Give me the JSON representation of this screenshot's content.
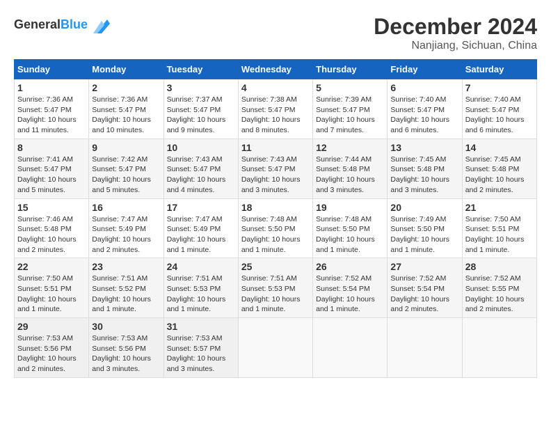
{
  "header": {
    "logo_line1": "General",
    "logo_line2": "Blue",
    "month": "December 2024",
    "location": "Nanjiang, Sichuan, China"
  },
  "calendar": {
    "days_of_week": [
      "Sunday",
      "Monday",
      "Tuesday",
      "Wednesday",
      "Thursday",
      "Friday",
      "Saturday"
    ],
    "weeks": [
      [
        {
          "day": "1",
          "sunrise": "Sunrise: 7:36 AM",
          "sunset": "Sunset: 5:47 PM",
          "daylight": "Daylight: 10 hours and 11 minutes."
        },
        {
          "day": "2",
          "sunrise": "Sunrise: 7:36 AM",
          "sunset": "Sunset: 5:47 PM",
          "daylight": "Daylight: 10 hours and 10 minutes."
        },
        {
          "day": "3",
          "sunrise": "Sunrise: 7:37 AM",
          "sunset": "Sunset: 5:47 PM",
          "daylight": "Daylight: 10 hours and 9 minutes."
        },
        {
          "day": "4",
          "sunrise": "Sunrise: 7:38 AM",
          "sunset": "Sunset: 5:47 PM",
          "daylight": "Daylight: 10 hours and 8 minutes."
        },
        {
          "day": "5",
          "sunrise": "Sunrise: 7:39 AM",
          "sunset": "Sunset: 5:47 PM",
          "daylight": "Daylight: 10 hours and 7 minutes."
        },
        {
          "day": "6",
          "sunrise": "Sunrise: 7:40 AM",
          "sunset": "Sunset: 5:47 PM",
          "daylight": "Daylight: 10 hours and 6 minutes."
        },
        {
          "day": "7",
          "sunrise": "Sunrise: 7:40 AM",
          "sunset": "Sunset: 5:47 PM",
          "daylight": "Daylight: 10 hours and 6 minutes."
        }
      ],
      [
        {
          "day": "8",
          "sunrise": "Sunrise: 7:41 AM",
          "sunset": "Sunset: 5:47 PM",
          "daylight": "Daylight: 10 hours and 5 minutes."
        },
        {
          "day": "9",
          "sunrise": "Sunrise: 7:42 AM",
          "sunset": "Sunset: 5:47 PM",
          "daylight": "Daylight: 10 hours and 5 minutes."
        },
        {
          "day": "10",
          "sunrise": "Sunrise: 7:43 AM",
          "sunset": "Sunset: 5:47 PM",
          "daylight": "Daylight: 10 hours and 4 minutes."
        },
        {
          "day": "11",
          "sunrise": "Sunrise: 7:43 AM",
          "sunset": "Sunset: 5:47 PM",
          "daylight": "Daylight: 10 hours and 3 minutes."
        },
        {
          "day": "12",
          "sunrise": "Sunrise: 7:44 AM",
          "sunset": "Sunset: 5:48 PM",
          "daylight": "Daylight: 10 hours and 3 minutes."
        },
        {
          "day": "13",
          "sunrise": "Sunrise: 7:45 AM",
          "sunset": "Sunset: 5:48 PM",
          "daylight": "Daylight: 10 hours and 3 minutes."
        },
        {
          "day": "14",
          "sunrise": "Sunrise: 7:45 AM",
          "sunset": "Sunset: 5:48 PM",
          "daylight": "Daylight: 10 hours and 2 minutes."
        }
      ],
      [
        {
          "day": "15",
          "sunrise": "Sunrise: 7:46 AM",
          "sunset": "Sunset: 5:48 PM",
          "daylight": "Daylight: 10 hours and 2 minutes."
        },
        {
          "day": "16",
          "sunrise": "Sunrise: 7:47 AM",
          "sunset": "Sunset: 5:49 PM",
          "daylight": "Daylight: 10 hours and 2 minutes."
        },
        {
          "day": "17",
          "sunrise": "Sunrise: 7:47 AM",
          "sunset": "Sunset: 5:49 PM",
          "daylight": "Daylight: 10 hours and 1 minute."
        },
        {
          "day": "18",
          "sunrise": "Sunrise: 7:48 AM",
          "sunset": "Sunset: 5:50 PM",
          "daylight": "Daylight: 10 hours and 1 minute."
        },
        {
          "day": "19",
          "sunrise": "Sunrise: 7:48 AM",
          "sunset": "Sunset: 5:50 PM",
          "daylight": "Daylight: 10 hours and 1 minute."
        },
        {
          "day": "20",
          "sunrise": "Sunrise: 7:49 AM",
          "sunset": "Sunset: 5:50 PM",
          "daylight": "Daylight: 10 hours and 1 minute."
        },
        {
          "day": "21",
          "sunrise": "Sunrise: 7:50 AM",
          "sunset": "Sunset: 5:51 PM",
          "daylight": "Daylight: 10 hours and 1 minute."
        }
      ],
      [
        {
          "day": "22",
          "sunrise": "Sunrise: 7:50 AM",
          "sunset": "Sunset: 5:51 PM",
          "daylight": "Daylight: 10 hours and 1 minute."
        },
        {
          "day": "23",
          "sunrise": "Sunrise: 7:51 AM",
          "sunset": "Sunset: 5:52 PM",
          "daylight": "Daylight: 10 hours and 1 minute."
        },
        {
          "day": "24",
          "sunrise": "Sunrise: 7:51 AM",
          "sunset": "Sunset: 5:53 PM",
          "daylight": "Daylight: 10 hours and 1 minute."
        },
        {
          "day": "25",
          "sunrise": "Sunrise: 7:51 AM",
          "sunset": "Sunset: 5:53 PM",
          "daylight": "Daylight: 10 hours and 1 minute."
        },
        {
          "day": "26",
          "sunrise": "Sunrise: 7:52 AM",
          "sunset": "Sunset: 5:54 PM",
          "daylight": "Daylight: 10 hours and 1 minute."
        },
        {
          "day": "27",
          "sunrise": "Sunrise: 7:52 AM",
          "sunset": "Sunset: 5:54 PM",
          "daylight": "Daylight: 10 hours and 2 minutes."
        },
        {
          "day": "28",
          "sunrise": "Sunrise: 7:52 AM",
          "sunset": "Sunset: 5:55 PM",
          "daylight": "Daylight: 10 hours and 2 minutes."
        }
      ],
      [
        {
          "day": "29",
          "sunrise": "Sunrise: 7:53 AM",
          "sunset": "Sunset: 5:56 PM",
          "daylight": "Daylight: 10 hours and 2 minutes."
        },
        {
          "day": "30",
          "sunrise": "Sunrise: 7:53 AM",
          "sunset": "Sunset: 5:56 PM",
          "daylight": "Daylight: 10 hours and 3 minutes."
        },
        {
          "day": "31",
          "sunrise": "Sunrise: 7:53 AM",
          "sunset": "Sunset: 5:57 PM",
          "daylight": "Daylight: 10 hours and 3 minutes."
        },
        null,
        null,
        null,
        null
      ]
    ]
  }
}
